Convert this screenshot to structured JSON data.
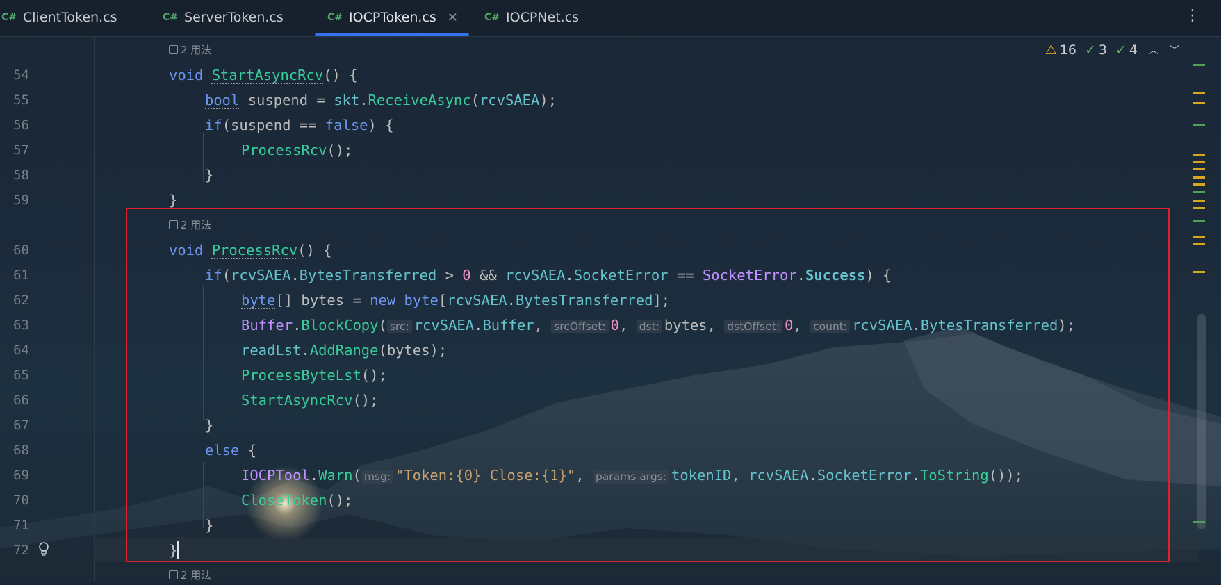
{
  "tabs": [
    {
      "icon": "C#",
      "label": "ClientToken.cs"
    },
    {
      "icon": "C#",
      "label": "ServerToken.cs"
    },
    {
      "icon": "C#",
      "label": "IOCPToken.cs",
      "active": true
    },
    {
      "icon": "C#",
      "label": "IOCPNet.cs"
    }
  ],
  "status": {
    "warnings": "16",
    "ok": "3",
    "typos": "4"
  },
  "usage_hint": "2 用法",
  "line_numbers": [
    "54",
    "55",
    "56",
    "57",
    "58",
    "59",
    "60",
    "61",
    "62",
    "63",
    "64",
    "65",
    "66",
    "67",
    "68",
    "69",
    "70",
    "71",
    "72"
  ],
  "code": {
    "l54": [
      "void",
      "StartAsyncRcv",
      "() {"
    ],
    "l55": [
      "bool",
      " suspend = ",
      "skt",
      ".",
      "ReceiveAsync",
      "(",
      "rcvSAEA",
      ");"
    ],
    "l56": [
      "if",
      "(suspend == ",
      "false",
      ") {"
    ],
    "l57": [
      "ProcessRcv",
      "();"
    ],
    "l58": "}",
    "l59": "}",
    "l60": [
      "void",
      "ProcessRcv",
      "() {"
    ],
    "l61": [
      "if",
      "(",
      "rcvSAEA",
      ".",
      "BytesTransferred",
      " > ",
      "0",
      " && ",
      "rcvSAEA",
      ".",
      "SocketError",
      " == ",
      "SocketError",
      ".",
      "Success",
      ") {"
    ],
    "l62": [
      "byte",
      "[] bytes = ",
      "new",
      "byte",
      "[",
      "rcvSAEA",
      ".",
      "BytesTransferred",
      "];"
    ],
    "l63": [
      "Buffer",
      ".",
      "BlockCopy",
      "(",
      "src:",
      "rcvSAEA",
      ".",
      "Buffer",
      ", ",
      "srcOffset:",
      "0",
      ", ",
      "dst:",
      "bytes, ",
      "dstOffset:",
      "0",
      ", ",
      "count:",
      "rcvSAEA",
      ".",
      "BytesTransferred",
      ");"
    ],
    "l64": [
      "readLst",
      ".",
      "AddRange",
      "(bytes);"
    ],
    "l65": [
      "ProcessByteLst",
      "();"
    ],
    "l66": [
      "StartAsyncRcv",
      "();"
    ],
    "l67": "}",
    "l68": [
      "else",
      " {"
    ],
    "l69": [
      "IOCPTool",
      ".",
      "Warn",
      "(",
      "msg:",
      "\"Token:{0} Close:{1}\"",
      ", ",
      "params args:",
      "tokenID",
      ", ",
      "rcvSAEA",
      ".",
      "SocketError",
      ".",
      "ToString",
      "());"
    ],
    "l70": [
      "CloseToken",
      "();"
    ],
    "l71": "}",
    "l72": "}"
  },
  "colors": {
    "keyword": "#6c95eb",
    "function": "#39cc9b",
    "type": "#c191ff",
    "field": "#66c3cc",
    "number": "#ed94c0",
    "string": "#c9a26d",
    "highlight_box": "#e0202a"
  }
}
